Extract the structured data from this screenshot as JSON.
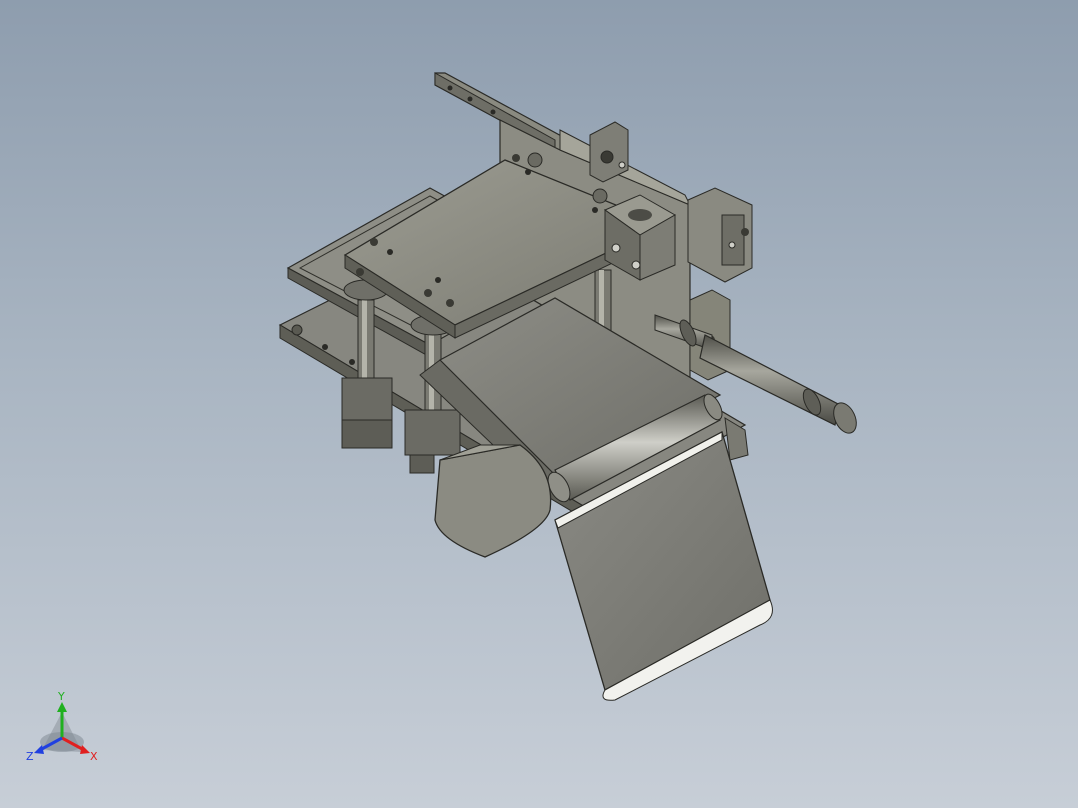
{
  "triad": {
    "x_label": "X",
    "y_label": "Y",
    "z_label": "Z",
    "x_color": "#e02020",
    "y_color": "#20b020",
    "z_color": "#2040e0"
  },
  "colors": {
    "background_top": "#8e9dae",
    "background_bottom": "#c7ced7",
    "metal_face": "#8a8a80",
    "metal_top": "#a3a398",
    "metal_dark": "#5e5e56",
    "belt": "#7b7b74",
    "cylinder": "#6c6c64"
  },
  "model": {
    "parts": [
      "top-plate",
      "frame-plate",
      "guide-rods",
      "conveyor-belt",
      "belt-roller",
      "chute-plate",
      "air-cylinder",
      "mounting-brackets",
      "side-rail"
    ]
  }
}
